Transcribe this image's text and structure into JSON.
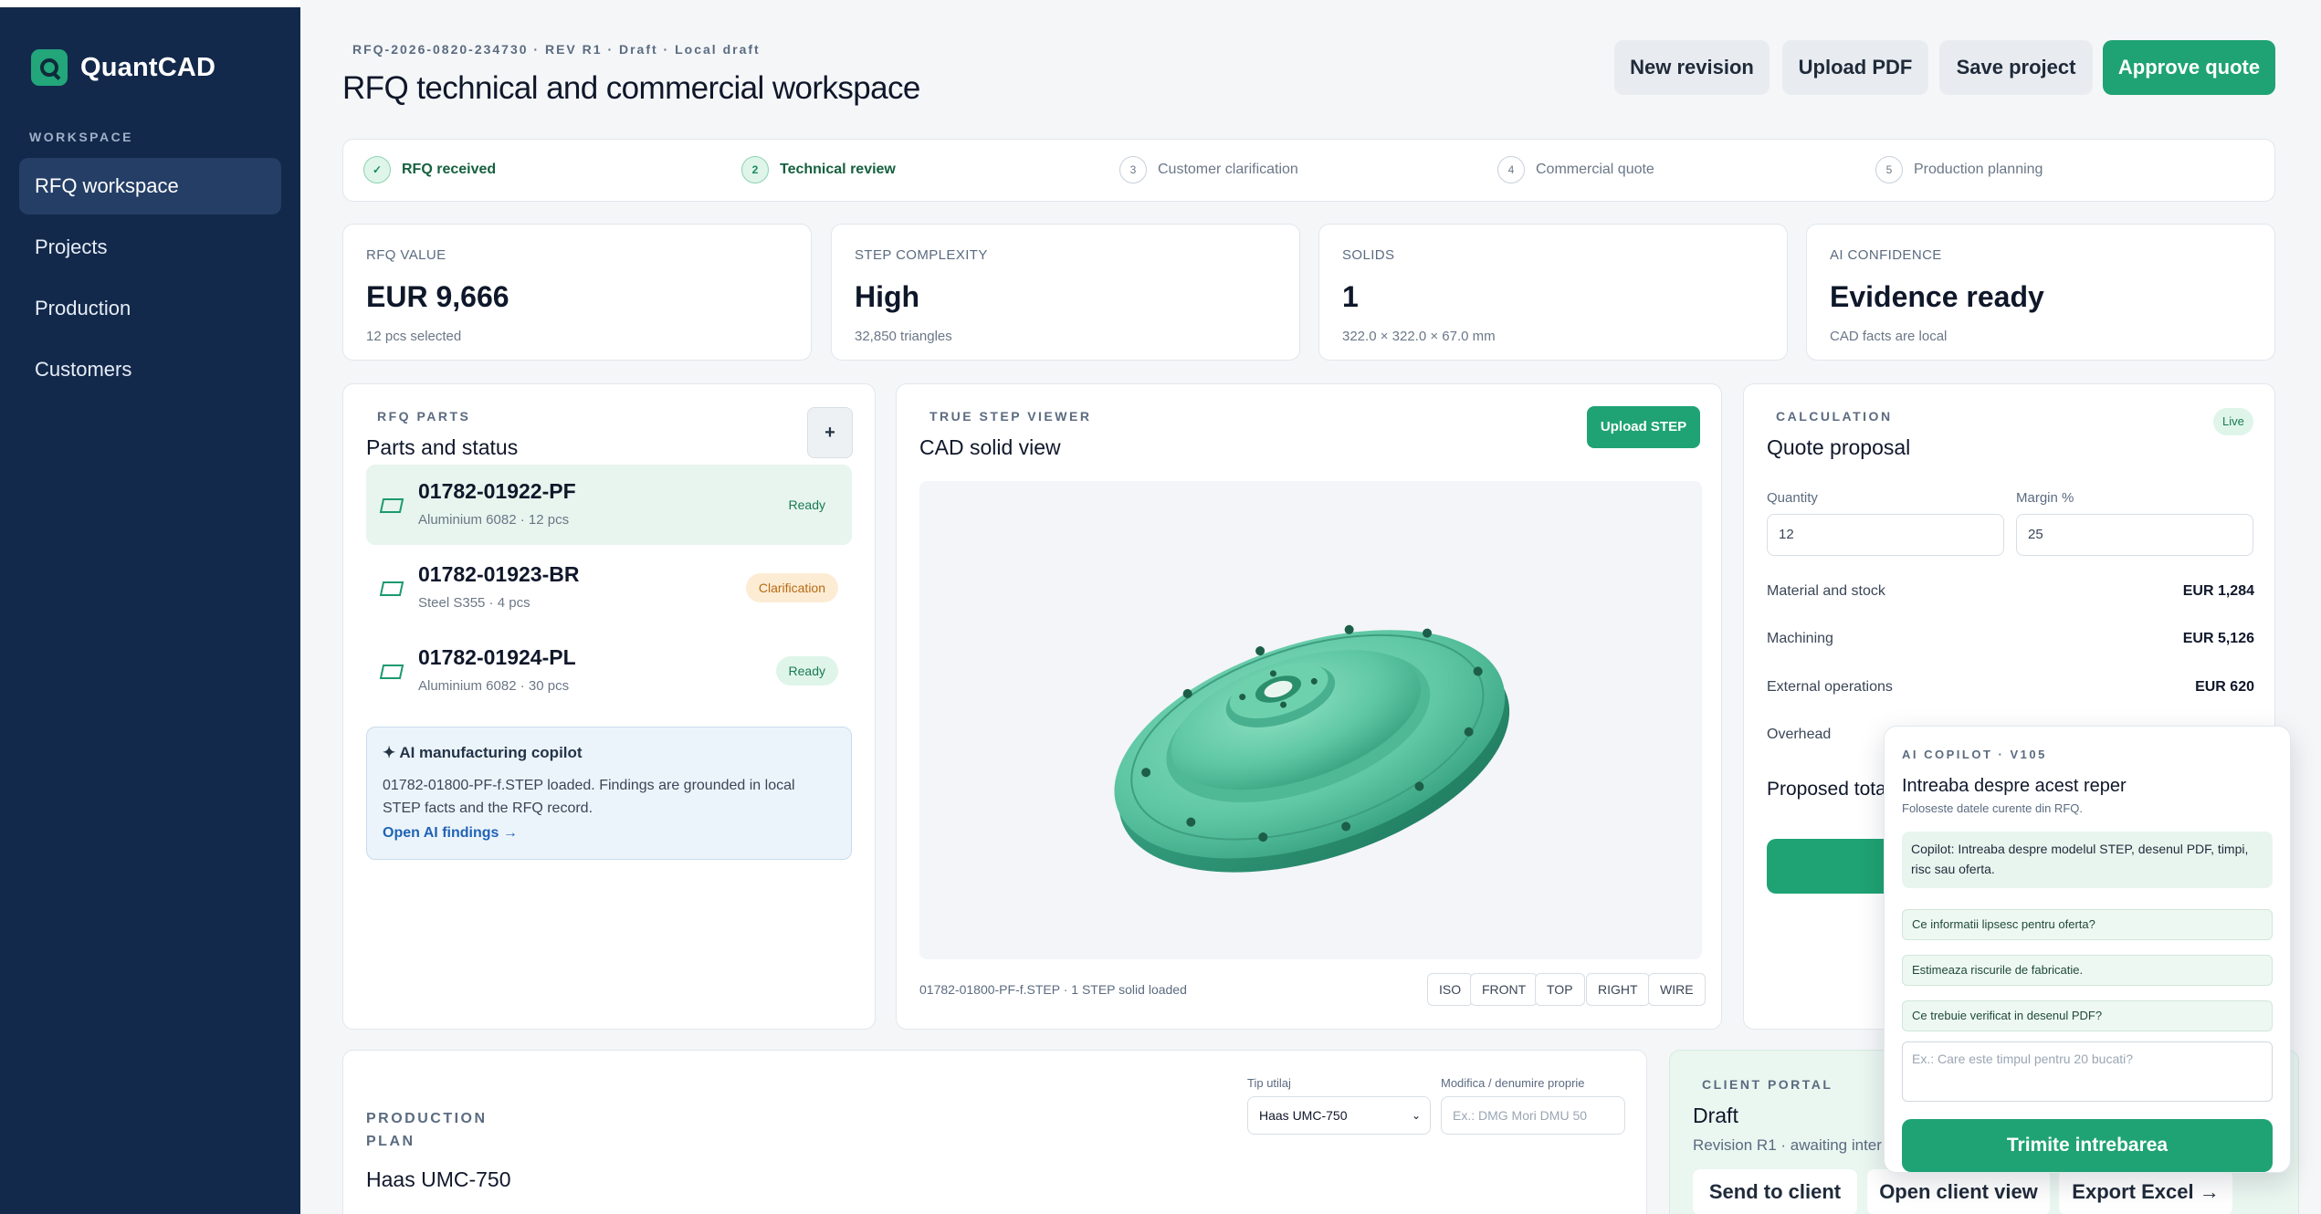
{
  "app": {
    "name": "QuantCAD"
  },
  "sidebar": {
    "section": "WORKSPACE",
    "items": [
      {
        "label": "RFQ workspace",
        "active": true
      },
      {
        "label": "Projects"
      },
      {
        "label": "Production"
      },
      {
        "label": "Customers"
      }
    ]
  },
  "header": {
    "crumb": "RFQ-2026-0820-234730 · REV R1 · Draft · Local draft",
    "title": "RFQ technical and commercial workspace",
    "buttons": {
      "new_revision": "New revision",
      "upload_pdf": "Upload PDF",
      "save_project": "Save project",
      "approve": "Approve quote"
    }
  },
  "stepper": [
    {
      "num": "✓",
      "label": "RFQ received",
      "state": "done"
    },
    {
      "num": "2",
      "label": "Technical review",
      "state": "current"
    },
    {
      "num": "3",
      "label": "Customer clarification",
      "state": "todo"
    },
    {
      "num": "4",
      "label": "Commercial quote",
      "state": "todo"
    },
    {
      "num": "5",
      "label": "Production planning",
      "state": "todo"
    }
  ],
  "kpis": [
    {
      "label": "RFQ VALUE",
      "value": "EUR 9,666",
      "sub": "12 pcs selected"
    },
    {
      "label": "STEP COMPLEXITY",
      "value": "High",
      "sub": "32,850 triangles"
    },
    {
      "label": "SOLIDS",
      "value": "1",
      "sub": "322.0 × 322.0 × 67.0 mm"
    },
    {
      "label": "AI CONFIDENCE",
      "value": "Evidence ready",
      "sub": "CAD facts are local"
    }
  ],
  "parts": {
    "eyebrow": "RFQ PARTS",
    "title": "Parts and status",
    "add": "+",
    "items": [
      {
        "name": "01782-01922-PF",
        "meta": "Aluminium 6082 · 12 pcs",
        "status": "Ready"
      },
      {
        "name": "01782-01923-BR",
        "meta": "Steel S355 · 4 pcs",
        "status": "Clarification"
      },
      {
        "name": "01782-01924-PL",
        "meta": "Aluminium 6082 · 30 pcs",
        "status": "Ready"
      }
    ],
    "copilot": {
      "title": "✦ AI manufacturing copilot",
      "text": "01782-01800-PF-f.STEP loaded. Findings are grounded in local STEP facts and the RFQ record.",
      "link": "Open AI findings →"
    }
  },
  "viewer": {
    "eyebrow": "TRUE STEP VIEWER",
    "title": "CAD solid view",
    "upload": "Upload STEP",
    "footer": "01782-01800-PF-f.STEP · 1 STEP solid loaded",
    "views": [
      "ISO",
      "FRONT",
      "TOP",
      "RIGHT",
      "WIRE"
    ],
    "model_color": "#5fc7a4"
  },
  "calc": {
    "eyebrow": "CALCULATION",
    "title": "Quote proposal",
    "live": "Live",
    "quantity_label": "Quantity",
    "quantity": "12",
    "margin_label": "Margin %",
    "margin": "25",
    "rows": [
      {
        "label": "Material and stock",
        "value": "EUR 1,284"
      },
      {
        "label": "Machining",
        "value": "EUR 5,126"
      },
      {
        "label": "External operations",
        "value": "EUR 620"
      },
      {
        "label": "Overhead",
        "value": ""
      }
    ],
    "total_label": "Proposed total"
  },
  "production": {
    "eyebrow": "PRODUCTION PLAN",
    "title": "Haas UMC-750",
    "tool_label": "Tip utilaj",
    "tool_value": "Haas UMC-750",
    "modify_label": "Modifica / denumire proprie",
    "modify_placeholder": "Ex.: DMG Mori DMU 50"
  },
  "portal": {
    "eyebrow": "CLIENT PORTAL",
    "title": "Draft",
    "sub": "Revision R1 · awaiting inter",
    "send": "Send to client",
    "open": "Open client view",
    "export": "Export Excel →"
  },
  "ai_panel": {
    "eyebrow": "AI COPILOT · V105",
    "title": "Intreaba despre acest reper",
    "sub": "Foloseste datele curente din RFQ.",
    "message": "Copilot: Intreaba despre modelul STEP, desenul PDF, timpi, risc sau oferta.",
    "suggestions": [
      "Ce informatii lipsesc pentru oferta?",
      "Estimeaza riscurile de fabricatie.",
      "Ce trebuie verificat in desenul PDF?"
    ],
    "placeholder": "Ex.: Care este timpul pentru 20 bucati?",
    "send": "Trimite intrebarea"
  },
  "colors": {
    "accent": "#1fa374",
    "sidebar": "#13294b"
  }
}
